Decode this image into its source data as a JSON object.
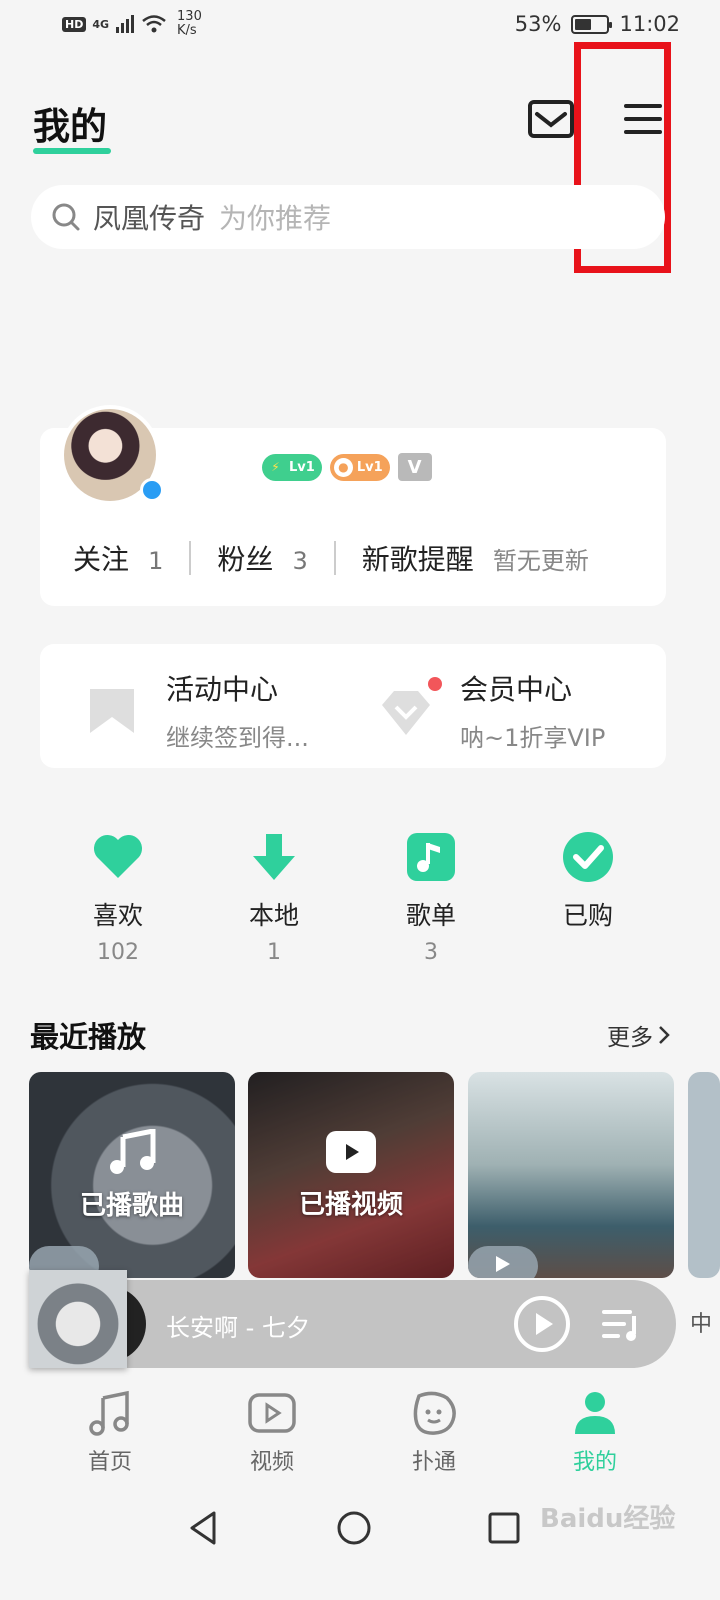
{
  "status_bar": {
    "hd": "HD",
    "network": "4G",
    "speed_value": "130",
    "speed_unit": "K/s",
    "battery_percent": "53%",
    "battery_level": 0.53,
    "time": "11:02"
  },
  "header": {
    "title": "我的"
  },
  "search": {
    "keyword": "凤凰传奇",
    "hint": "为你推荐"
  },
  "profile": {
    "badge_lv1": "Lv1",
    "badge_lv2": "Lv1",
    "badge_vip": "V",
    "following_label": "关注",
    "following_count": "1",
    "fans_label": "粉丝",
    "fans_count": "3",
    "new_song_label": "新歌提醒",
    "new_song_status": "暂无更新"
  },
  "activity": {
    "left_title": "活动中心",
    "left_sub": "继续签到得...",
    "right_title": "会员中心",
    "right_sub": "呐~1折享VIP"
  },
  "quick_actions": [
    {
      "label": "喜欢",
      "count": "102"
    },
    {
      "label": "本地",
      "count": "1"
    },
    {
      "label": "歌单",
      "count": "3"
    },
    {
      "label": "已购",
      "count": ""
    }
  ],
  "recent": {
    "title": "最近播放",
    "more": "更多",
    "cards": [
      {
        "label": "已播歌曲"
      },
      {
        "label": "已播视频"
      }
    ]
  },
  "player": {
    "track": "长安啊 - 七夕",
    "edge_char": "中"
  },
  "bottom_nav": [
    {
      "label": "首页"
    },
    {
      "label": "视频"
    },
    {
      "label": "扑通"
    },
    {
      "label": "我的"
    }
  ],
  "watermark": "Baidu经验",
  "colors": {
    "accent": "#2fd09c",
    "highlight_box": "#e8121a",
    "notification_dot": "#f2565a"
  }
}
